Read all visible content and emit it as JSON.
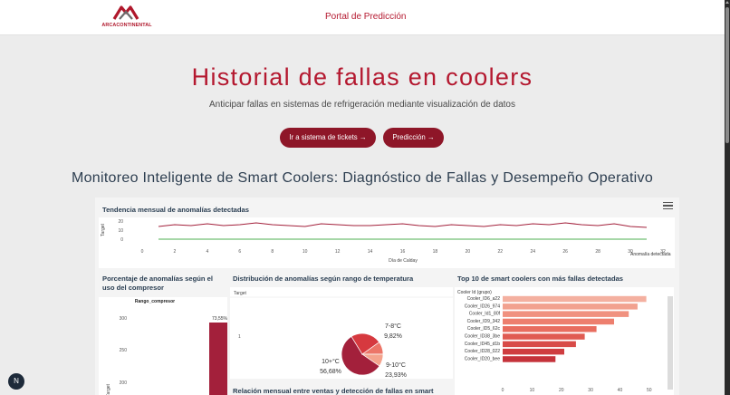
{
  "header": {
    "logo_text": "ARCACONTINENTAL",
    "portal_link": "Portal de Predicción"
  },
  "hero": {
    "title": "Historial de fallas en coolers",
    "subtitle": "Anticipar fallas en sistemas de refrigeración mediante visualización de datos",
    "btn_tickets": "Ir a sistema de tickets →",
    "btn_prediction": "Predicción →"
  },
  "section": {
    "title": "Monitoreo Inteligente de Smart Coolers: Diagnóstico de Fallas y Desempeño Operativo"
  },
  "fab": {
    "label": "N"
  },
  "colors": {
    "brand": "#b4182f",
    "button": "#8e1628",
    "navy": "#2d3e50"
  },
  "chart_data": [
    {
      "type": "line",
      "title": "Tendencia mensual de anomalías detectadas",
      "xlabel": "Día de Calday",
      "ylabel": "Target",
      "xlim": [
        0,
        32
      ],
      "ylim": [
        0,
        20
      ],
      "x_ticks": [
        "0",
        "2",
        "4",
        "6",
        "8",
        "10",
        "12",
        "14",
        "16",
        "18",
        "20",
        "22",
        "24",
        "26",
        "28",
        "30",
        "32"
      ],
      "y_ticks": [
        "20",
        "10",
        "0"
      ],
      "legend": [
        "Anomalía detectada"
      ],
      "series": [
        {
          "name": "Anomalía detectada",
          "color": "#a3203b",
          "x": [
            1,
            2,
            3,
            4,
            5,
            6,
            7,
            8,
            9,
            10,
            11,
            12,
            13,
            14,
            15,
            16,
            17,
            18,
            19,
            20,
            21,
            22,
            23,
            24,
            25,
            26,
            27,
            28,
            29,
            30,
            31
          ],
          "values": [
            14,
            16,
            15,
            17,
            15,
            16,
            18,
            16,
            15,
            14,
            17,
            16,
            15,
            15,
            16,
            17,
            15,
            14,
            16,
            15,
            14,
            16,
            15,
            17,
            16,
            18,
            16,
            15,
            17,
            14,
            13
          ]
        },
        {
          "name": "",
          "color": "#4caf50",
          "x": [
            1,
            31
          ],
          "values": [
            0,
            0
          ]
        }
      ]
    },
    {
      "type": "bar",
      "title": "Porcentaje de anomalías según el uso del compresor",
      "legend": [
        "Rango_compresor"
      ],
      "ylabel": "Target",
      "y_ticks": [
        "300",
        "250",
        "200"
      ],
      "series": [
        {
          "name": "Rango_compresor",
          "values": [
            73.55
          ]
        }
      ],
      "data_labels": [
        "73,55%"
      ]
    },
    {
      "type": "pie",
      "title": "Distribución de anomalías según rango de temperatura",
      "ylabel": "Target",
      "y_ticks": [
        "1"
      ],
      "slices": [
        {
          "label": "10+°C",
          "value": 56.68,
          "text": "56,68%",
          "color": "#a3203b"
        },
        {
          "label": "9-10°C",
          "value": 23.93,
          "text": "23,93%",
          "color": "#d6393f"
        },
        {
          "label": "7-8°C",
          "value": 9.82,
          "text": "9,82%",
          "color": "#ec7568"
        },
        {
          "label": "",
          "value": 9.57,
          "text": "",
          "color": "#f4a38d"
        }
      ]
    },
    {
      "type": "bar",
      "orientation": "horizontal",
      "title": "Top 10 de smart coolers con más fallas detectadas",
      "legend": [
        "Cooler Id (grupo)"
      ],
      "categories": [
        "Cooler_ID6_a22",
        "Cooler_ID26_974",
        "Cooler_Id1_80f",
        "Cooler_ID9_342",
        "Cooler_ID5_62c",
        "Cooler_ID38_3be",
        "Cooler_ID45_d1b",
        "Cooler_ID28_022",
        "Cooler_ID20_bee"
      ],
      "values": [
        49,
        46,
        43,
        38,
        32,
        28,
        25,
        21,
        18
      ],
      "x_ticks": [
        "0",
        "10",
        "20",
        "30",
        "40",
        "50"
      ],
      "xlim": [
        0,
        55
      ]
    },
    {
      "type": "line",
      "title": "Relación mensual entre ventas y detección de fallas en smart"
    }
  ]
}
